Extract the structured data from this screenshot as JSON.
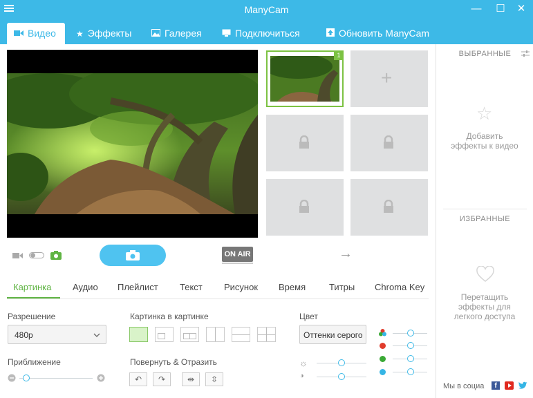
{
  "window": {
    "title": "ManyCam",
    "minimize": "—",
    "maximize": "☐",
    "close": "✕"
  },
  "nav": {
    "tabs": [
      {
        "label": "Видео",
        "icon": "video-camera-icon",
        "active": true
      },
      {
        "label": "Эффекты",
        "icon": "star-icon"
      },
      {
        "label": "Галерея",
        "icon": "image-icon"
      },
      {
        "label": "Подключиться",
        "icon": "monitor-icon"
      },
      {
        "label": "Обновить ManyCam",
        "icon": "upload-icon"
      }
    ]
  },
  "presets": {
    "active_badge": "1"
  },
  "controls": {
    "on_air": "ON AIR",
    "arrow": "→"
  },
  "subtabs": [
    "Картинка",
    "Аудио",
    "Плейлист",
    "Текст",
    "Рисунок",
    "Время",
    "Титры",
    "Chroma Key"
  ],
  "settings": {
    "resolution_label": "Разрешение",
    "resolution_value": "480p",
    "zoom_label": "Приближение",
    "pip_label": "Картинка в картинке",
    "rotate_label": "Повернуть & Отразить",
    "color_label": "Цвет",
    "color_value": "Оттенки серого"
  },
  "sidebar": {
    "favorites_title": "ВЫБРАННЫЕ",
    "favorites_hint": "Добавить эффекты к видео",
    "featured_title": "ИЗБРАННЫЕ",
    "featured_hint": "Перетащить эффекты для легкого доступа",
    "social_text": "Мы в социа"
  },
  "colors": {
    "accent": "#3db9e7",
    "active_green": "#5fb443",
    "red": "#e03c2c",
    "green": "#3aa935",
    "blue": "#35b5e5"
  }
}
